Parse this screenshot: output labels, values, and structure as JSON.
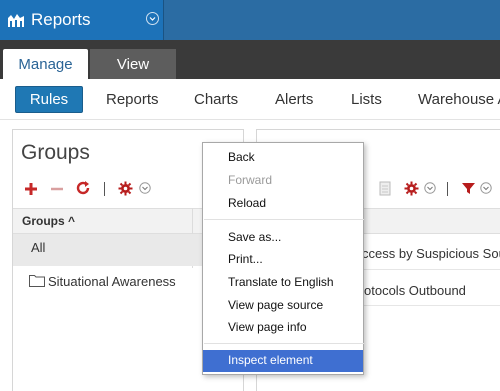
{
  "header": {
    "app_title": "Reports",
    "brand_color": "#1d72b8",
    "logo_icon": "bar-chart-icon"
  },
  "tabs": [
    {
      "label": "Manage",
      "active": true
    },
    {
      "label": "View",
      "active": false
    }
  ],
  "nav": {
    "items": [
      "Rules",
      "Reports",
      "Charts",
      "Alerts",
      "Lists",
      "Warehouse A"
    ],
    "active": "Rules"
  },
  "groups_panel": {
    "title": "Groups",
    "toolbar_icons": [
      "add-icon",
      "remove-icon",
      "refresh-icon",
      "settings-gear-icon",
      "chevron-down-icon"
    ],
    "column_header": "Groups ^",
    "rows": [
      "All",
      "Situational Awareness"
    ],
    "selected_row": "All"
  },
  "rules_panel": {
    "toolbar_icons": [
      "copy-icon",
      "settings-gear-icon",
      "chevron-down-icon",
      "filter-icon",
      "chevron-down-icon"
    ],
    "rows": [
      "ccess by Suspicious Sou",
      "otocols Outbound"
    ]
  },
  "context_menu": {
    "items": {
      "back": "Back",
      "forward": "Forward",
      "reload": "Reload",
      "save_as": "Save as...",
      "print": "Print...",
      "translate": "Translate to English",
      "view_source": "View page source",
      "view_info": "View page info",
      "inspect": "Inspect element"
    },
    "disabled": [
      "Forward"
    ],
    "highlighted": "Inspect element",
    "highlight_color": "#3f6fd1"
  }
}
